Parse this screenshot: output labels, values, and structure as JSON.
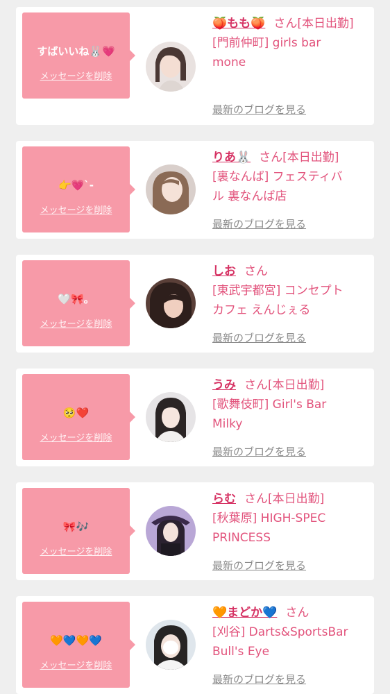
{
  "delete_label": "メッセージを削除",
  "blog_label": "最新のブログを見る",
  "san_label": "さん",
  "colors": {
    "bubble": "#f79aa8",
    "name": "#d63364",
    "text": "#e2537c",
    "link_gray": "#8a8a8a",
    "card": "#ffffff",
    "background": "#efefef"
  },
  "cards": [
    {
      "message": "すばいいね🐰💗",
      "name": "🍑もも🍑",
      "status": "[本日出勤]",
      "shop_lines": [
        "[門前仲町] girls bar",
        "mone"
      ],
      "avatar_icon": "profile-photo-icon"
    },
    {
      "message": "👉💗`-",
      "name": "りあ🐰",
      "status": "[本日出勤]",
      "shop_lines": [
        "[裏なんば] フェスティバ",
        "ル 裏なんば店"
      ],
      "avatar_icon": "profile-photo-icon"
    },
    {
      "message": "🤍🎀。",
      "name": "しお",
      "status": "",
      "shop_lines": [
        "[東武宇都宮] コンセプト",
        "カフェ えんじぇる"
      ],
      "avatar_icon": "profile-photo-icon"
    },
    {
      "message": "🥺❤️",
      "name": "うみ",
      "status": "[本日出勤]",
      "shop_lines": [
        "[歌舞伎町] Girl's Bar",
        "Milky"
      ],
      "avatar_icon": "profile-photo-icon"
    },
    {
      "message": "🎀🎶",
      "name": "らむ",
      "status": "[本日出勤]",
      "shop_lines": [
        "[秋葉原] HIGH-SPEC",
        "PRINCESS"
      ],
      "avatar_icon": "profile-photo-icon"
    },
    {
      "message": "🧡💙🧡💙",
      "name": "🧡まどか💙",
      "status": "",
      "shop_lines": [
        "[刈谷] Darts&SportsBar",
        "Bull's Eye"
      ],
      "avatar_icon": "profile-photo-icon"
    }
  ]
}
